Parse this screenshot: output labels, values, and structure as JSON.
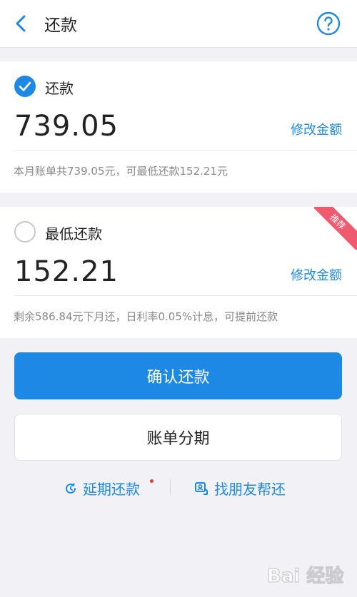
{
  "header": {
    "title": "还款"
  },
  "full_payment": {
    "label": "还款",
    "amount": "739.05",
    "modify_label": "修改金额",
    "note": "本月账单共739.05元，可最低还款152.21元",
    "checked": true
  },
  "min_payment": {
    "label": "最低还款",
    "amount": "152.21",
    "modify_label": "修改金额",
    "note": "剩余586.84元下月还，日利率0.05%计息，可提前还款",
    "badge": "推荐",
    "checked": false
  },
  "actions": {
    "confirm_label": "确认还款",
    "installment_label": "账单分期"
  },
  "links": {
    "delay_label": "延期还款",
    "friend_label": "找朋友帮还"
  },
  "watermark": {
    "text": "Bai 经验"
  },
  "colors": {
    "accent": "#1e88e5",
    "badge": "#ef5a6f",
    "background": "#f2f2f6"
  }
}
